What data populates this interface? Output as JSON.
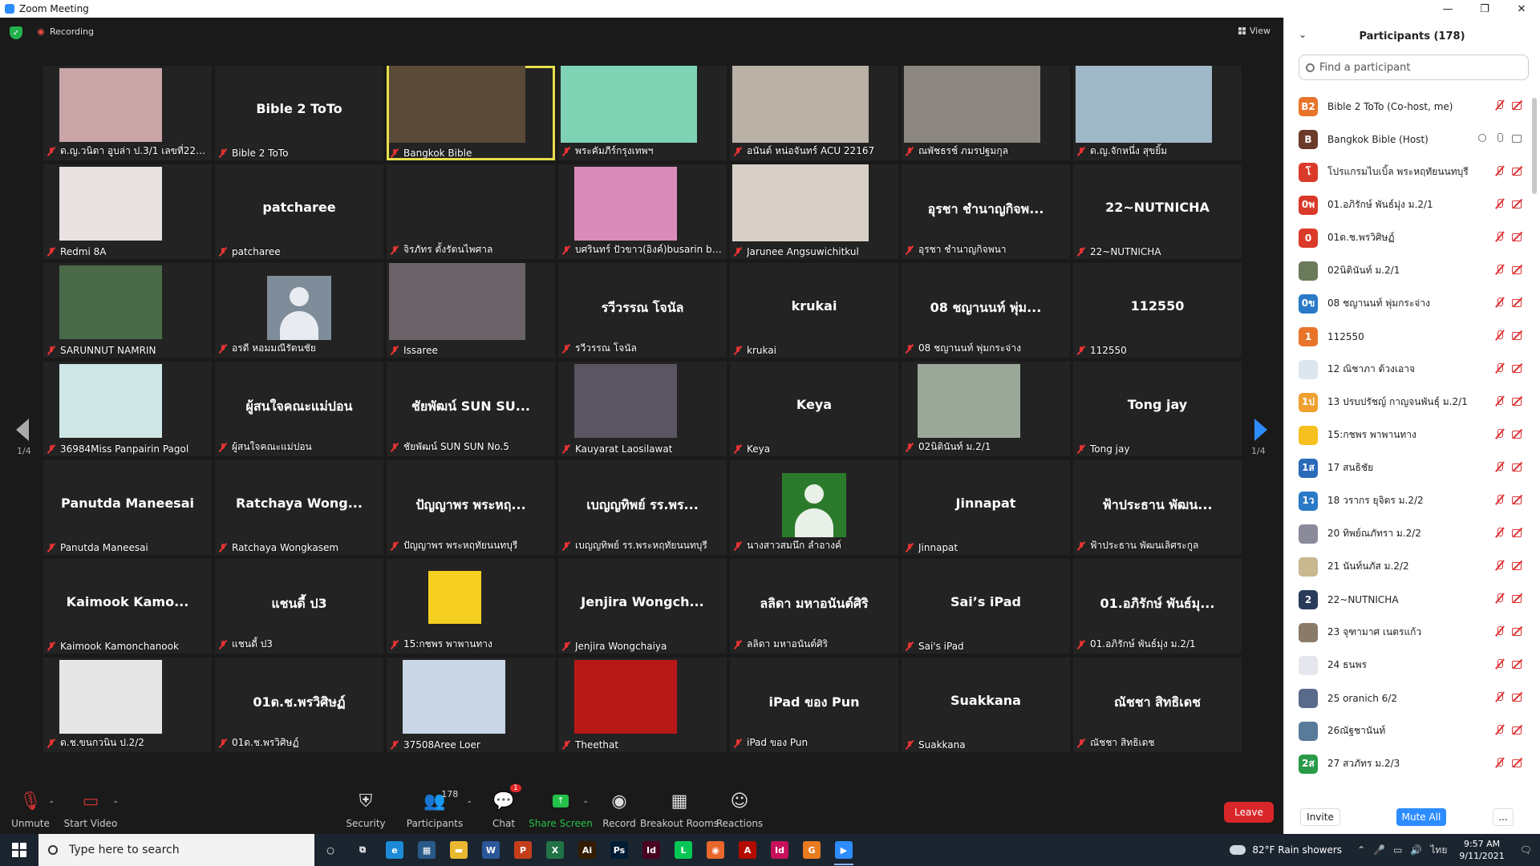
{
  "window": {
    "title": "Zoom Meeting",
    "controls": [
      "—",
      "❐",
      "✕"
    ]
  },
  "meeting": {
    "recording_label": "Recording",
    "view_label": "View",
    "page_indicator_left": "1/4",
    "page_indicator_right": "1/4",
    "tiles": [
      {
        "label": "ด.ญ.วนิดา อูบล่า ป.3/1 เลขที่22(w...",
        "kind": "video",
        "thumb": "#c9a5a8"
      },
      {
        "label": "Bible 2 ToTo",
        "kind": "name",
        "center": "Bible 2 ToTo"
      },
      {
        "label": "Bangkok Bible",
        "kind": "video-full",
        "thumb": "#5a4a38",
        "active": true
      },
      {
        "label": "พระคัมภีร์กรุงเทพฯ",
        "kind": "video-full",
        "thumb": "#7fd3b5"
      },
      {
        "label": "อนันต์ หน่อจันทร์ ACU 22167",
        "kind": "video-full",
        "thumb": "#b9b0a6"
      },
      {
        "label": "ณพัชธรช์ ภมรปฐมกุล",
        "kind": "video-full",
        "thumb": "#8c8680"
      },
      {
        "label": "ด.ญ.จักหนึ่ง สุขยิ้ม",
        "kind": "video-full",
        "thumb": "#9fb8c8"
      },
      {
        "label": "Redmi 8A",
        "kind": "video",
        "thumb": "#e8e2e2"
      },
      {
        "label": "patcharee",
        "kind": "name",
        "center": "patcharee"
      },
      {
        "label": "จิรภัทร ตั้งรัตนไพศาล",
        "kind": "blank"
      },
      {
        "label": "บศรินทร์ ปัวขาว(อิงค์)busarin bu...",
        "kind": "video",
        "thumb": "#d98cb8"
      },
      {
        "label": "Jarunee Angsuwichitkul",
        "kind": "video-full",
        "thumb": "#d8cfc8"
      },
      {
        "label": "อุรชา ชำนาญกิจพนา",
        "kind": "name",
        "center": "อุรชา ชำนาญกิจพ..."
      },
      {
        "label": "22~NUTNICHA",
        "kind": "name",
        "center": "22~NUTNICHA"
      },
      {
        "label": "SARUNNUT NAMRIN",
        "kind": "video",
        "thumb": "#4a6a48"
      },
      {
        "label": "อรดี หอมมณีรัตนชัย",
        "kind": "avatar-gray"
      },
      {
        "label": "Issaree",
        "kind": "video-full",
        "thumb": "#6a6468"
      },
      {
        "label": "รวีวรรณ โจนัล",
        "kind": "name",
        "center": "รวีวรรณ โจนัล"
      },
      {
        "label": "krukai",
        "kind": "name",
        "center": "krukai"
      },
      {
        "label": "08 ชญานนท์ พุ่มกระจ่าง",
        "kind": "name",
        "center": "08 ชญานนท์ พุ่ม..."
      },
      {
        "label": "112550",
        "kind": "name",
        "center": "112550"
      },
      {
        "label": "36984Miss Panpairin Pagol",
        "kind": "video",
        "thumb": "#cfe6e6"
      },
      {
        "label": "ผู้สนใจคณะแม่ปอน",
        "kind": "name",
        "center": "ผู้สนใจคณะแม่ปอน"
      },
      {
        "label": "ชัยพัฒน์ SUN SUN No.5",
        "kind": "name",
        "center": "ชัยพัฒน์ SUN SU..."
      },
      {
        "label": "Kauyarat Laosilawat",
        "kind": "video",
        "thumb": "#5a5560"
      },
      {
        "label": "Keya",
        "kind": "name",
        "center": "Keya"
      },
      {
        "label": "02นิตินันท์ ม.2/1",
        "kind": "video",
        "thumb": "#9aa89a"
      },
      {
        "label": "Tong jay",
        "kind": "name",
        "center": "Tong jay"
      },
      {
        "label": "Panutda Maneesai",
        "kind": "name",
        "center": "Panutda Maneesai"
      },
      {
        "label": "Ratchaya Wongkasem",
        "kind": "name",
        "center": "Ratchaya  Wong..."
      },
      {
        "label": "ปัญญาพร พระหฤทัยนนทบุรี",
        "kind": "name",
        "center": "ปัญญาพร พระหฤ..."
      },
      {
        "label": "เบญญทิพย์ รร.พระหฤทัยนนทบุรี",
        "kind": "name",
        "center": "เบญญทิพย์ รร.พร..."
      },
      {
        "label": "นางสาวสมนึก ลำอางค์",
        "kind": "avatar-green"
      },
      {
        "label": "Jinnapat",
        "kind": "name",
        "center": "Jinnapat"
      },
      {
        "label": "ฟ้าประธาน พัฒนเลิศระกูล",
        "kind": "name",
        "center": "ฟ้าประธาน พัฒน..."
      },
      {
        "label": "Kaimook Kamonchanook",
        "kind": "name",
        "center": "Kaimook  Kamo..."
      },
      {
        "label": "แชนดี้ ป3",
        "kind": "name",
        "center": "แชนดี้ ป3"
      },
      {
        "label": "15:กชพร พาพานทาง",
        "kind": "video",
        "thumb": "#f5d020"
      },
      {
        "label": "Jenjira Wongchaiya",
        "kind": "name",
        "center": "Jenjira  Wongch..."
      },
      {
        "label": "ลลิดา มหาอนันต์ศิริ",
        "kind": "name",
        "center": "ลลิดา มหาอนันต์ศิริ"
      },
      {
        "label": "Sai's iPad",
        "kind": "name",
        "center": "Sai’s iPad"
      },
      {
        "label": "01.อภิรักษ์ พันธ์มุ่ง ม.2/1",
        "kind": "name",
        "center": "01.อภิรักษ์ พันธ์มุ..."
      },
      {
        "label": "ด.ช.ขนกวนิน ป.2/2",
        "kind": "video",
        "thumb": "#e6e6e6"
      },
      {
        "label": "01ด.ช.พรวิศิษฏ์",
        "kind": "name",
        "center": "01ด.ช.พรวิศิษฏ์"
      },
      {
        "label": "37508Aree Loer",
        "kind": "video",
        "thumb": "#c9d6e6"
      },
      {
        "label": "Theethat",
        "kind": "video",
        "thumb": "#b81818"
      },
      {
        "label": "iPad ของ Pun",
        "kind": "name",
        "center": "iPad ของ Pun"
      },
      {
        "label": "Suakkana",
        "kind": "name",
        "center": "Suakkana"
      },
      {
        "label": "ณัชชา สิทธิเดช",
        "kind": "name",
        "center": "ณัชชา สิทธิเดช"
      }
    ]
  },
  "toolbar": {
    "unmute": "Unmute",
    "start_video": "Start Video",
    "security": "Security",
    "participants": "Participants",
    "participants_count": "178",
    "chat": "Chat",
    "chat_badge": "1",
    "share_screen": "Share Screen",
    "record": "Record",
    "breakout": "Breakout Rooms",
    "reactions": "Reactions",
    "leave": "Leave"
  },
  "panel": {
    "title": "Participants (178)",
    "search_placeholder": "Find a participant",
    "participants": [
      {
        "initials": "B2",
        "color": "#e8742a",
        "name": "Bible 2 ToTo (Co-host, me)",
        "muted": true
      },
      {
        "initials": "B",
        "color": "#6b3a2a",
        "name": "Bangkok Bible (Host)",
        "muted": false
      },
      {
        "initials": "โ",
        "color": "#d93a2a",
        "name": "โปรแกรมไบเบิ้ล พระหฤทัยนนทบุรี",
        "muted": true
      },
      {
        "initials": "0พ",
        "color": "#d93a2a",
        "name": "01.อภิรักษ์ พันธ์มุ่ง ม.2/1",
        "muted": true
      },
      {
        "initials": "0",
        "color": "#d93a2a",
        "name": "01ด.ช.พรวิศิษฏ์",
        "muted": true
      },
      {
        "initials": "",
        "color": "#6a7a5a",
        "name": "02นิตินันท์ ม.2/1",
        "muted": true
      },
      {
        "initials": "0ข",
        "color": "#2a7ac8",
        "name": "08 ชญานนท์ พุ่มกระจ่าง",
        "muted": true
      },
      {
        "initials": "1",
        "color": "#e8742a",
        "name": "112550",
        "muted": true
      },
      {
        "initials": "",
        "color": "#dde6ee",
        "name": "12 ณิชาภา ด้วงเอาจ",
        "muted": true
      },
      {
        "initials": "1ป",
        "color": "#f0a030",
        "name": "13 ปรบปรัชญ์ กาญจนพันธุ์ ม.2/1",
        "muted": true
      },
      {
        "initials": "",
        "color": "#f5c020",
        "name": "15:กชพร พาพานทาง",
        "muted": true
      },
      {
        "initials": "1ส",
        "color": "#2a6ab8",
        "name": "17 สนธิชัย",
        "muted": true
      },
      {
        "initials": "1ว",
        "color": "#2a7ac8",
        "name": "18 วรากร ยุจิตร ม.2/2",
        "muted": true
      },
      {
        "initials": "",
        "color": "#8a8a9a",
        "name": "20 ทิพย์ณภัทรา ม.2/2",
        "muted": true
      },
      {
        "initials": "",
        "color": "#c8b890",
        "name": "21 นันท์นภัส ม.2/2",
        "muted": true
      },
      {
        "initials": "2",
        "color": "#2a3a5a",
        "name": "22~NUTNICHA",
        "muted": true
      },
      {
        "initials": "",
        "color": "#8a7a6a",
        "name": "23 จุฑามาศ เนตรแก้ว",
        "muted": true
      },
      {
        "initials": "",
        "color": "#e6e6ee",
        "name": "24 ธนพร",
        "muted": true
      },
      {
        "initials": "",
        "color": "#5a6a8a",
        "name": "25 oranich 6/2",
        "muted": true
      },
      {
        "initials": "",
        "color": "#5a7a9a",
        "name": "26ณัฐชานันท์",
        "muted": true
      },
      {
        "initials": "2ส",
        "color": "#2a9a4a",
        "name": "27 สวภัทร  ม.2/3",
        "muted": true
      }
    ],
    "invite": "Invite",
    "mute_all": "Mute All",
    "more": "..."
  },
  "taskbar": {
    "search_placeholder": "Type here to search",
    "weather": "82°F  Rain showers",
    "language": "ไทย",
    "time": "9:57 AM",
    "date": "9/11/2021",
    "apps": [
      {
        "name": "cortana",
        "label": "○",
        "color": "transparent"
      },
      {
        "name": "task-view",
        "label": "⧉",
        "color": "transparent"
      },
      {
        "name": "edge",
        "label": "e",
        "color": "#1c8ad6"
      },
      {
        "name": "calculator",
        "label": "▦",
        "color": "#2a5a8a"
      },
      {
        "name": "file-explorer",
        "label": "▬",
        "color": "#e8b830"
      },
      {
        "name": "word",
        "label": "W",
        "color": "#2b579a"
      },
      {
        "name": "powerpoint",
        "label": "P",
        "color": "#c43e1c"
      },
      {
        "name": "excel",
        "label": "X",
        "color": "#217346"
      },
      {
        "name": "illustrator",
        "label": "Ai",
        "color": "#331c00"
      },
      {
        "name": "photoshop",
        "label": "Ps",
        "color": "#001d34"
      },
      {
        "name": "indesign",
        "label": "Id",
        "color": "#49021f"
      },
      {
        "name": "line",
        "label": "L",
        "color": "#06c755"
      },
      {
        "name": "firefox",
        "label": "◉",
        "color": "#e8662a"
      },
      {
        "name": "acrobat",
        "label": "A",
        "color": "#b30b00"
      },
      {
        "name": "indesign-2",
        "label": "Id",
        "color": "#c8105a"
      },
      {
        "name": "grammarly",
        "label": "G",
        "color": "#e87a20"
      },
      {
        "name": "zoom",
        "label": "▶",
        "color": "#2d8cff"
      }
    ]
  }
}
